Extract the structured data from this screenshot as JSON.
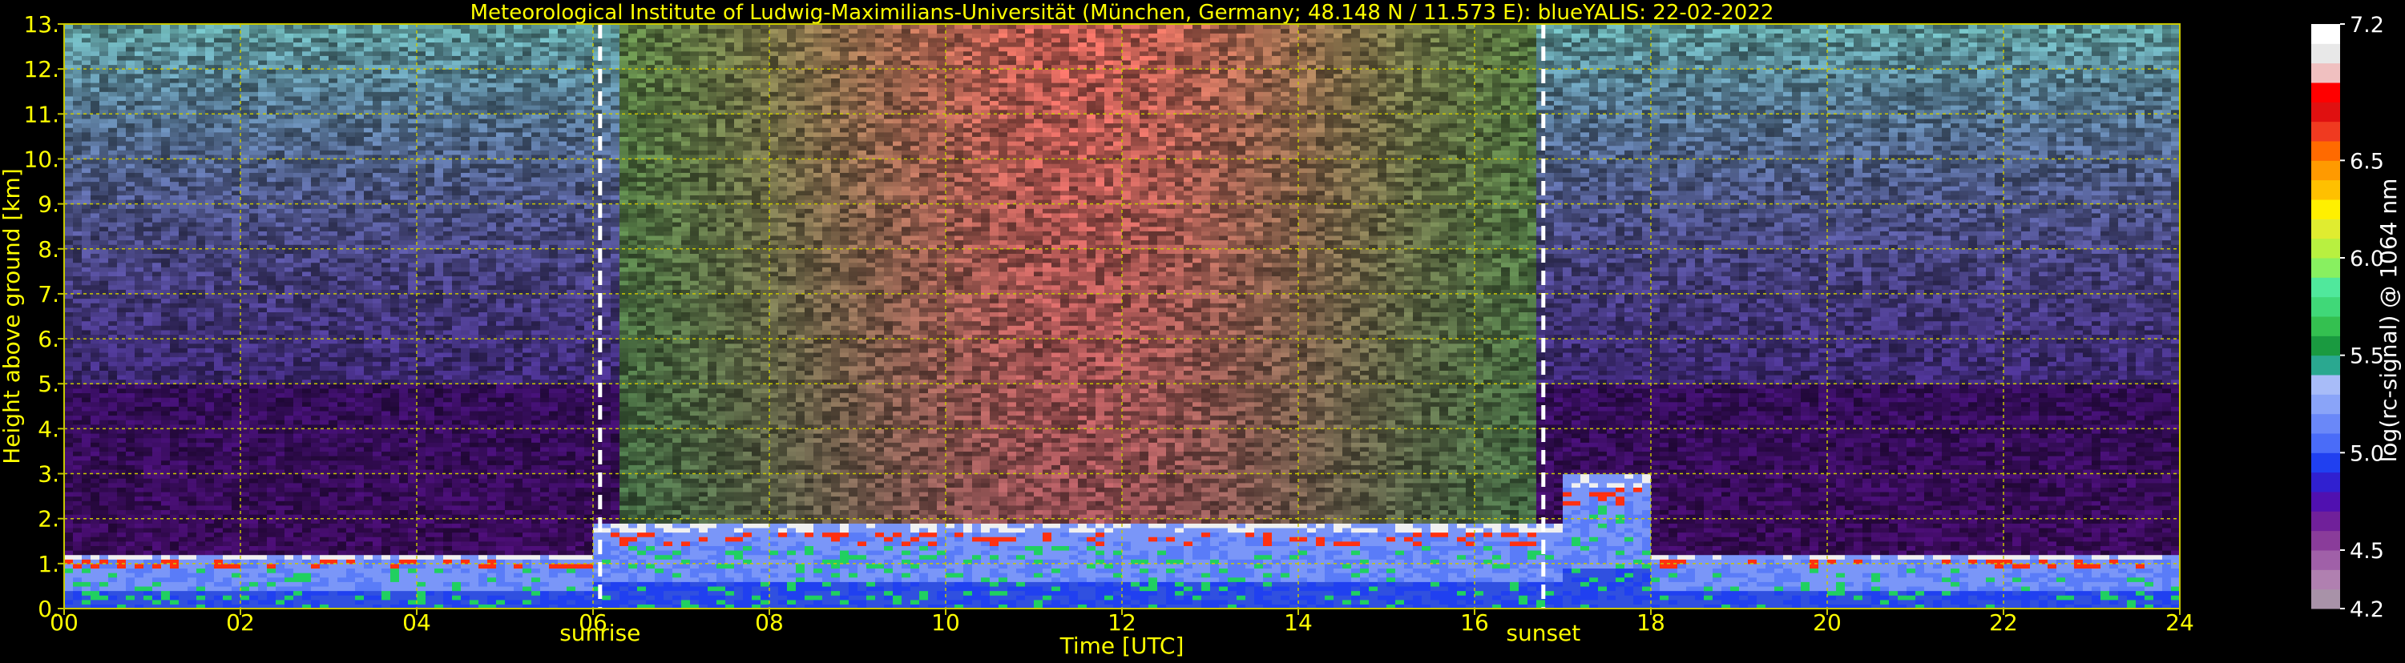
{
  "chart_data": {
    "type": "heatmap",
    "title": "Meteorological Institute of Ludwig-Maximilians-Universität (München, Germany; 48.148 N / 11.573 E):     blueYALIS: 22-02-2022",
    "xlabel": "Time [UTC]",
    "ylabel": "Height above ground [km]",
    "xlim": [
      0,
      24
    ],
    "ylim": [
      0,
      13
    ],
    "x_ticks": [
      "00",
      "02",
      "04",
      "06",
      "08",
      "10",
      "12",
      "14",
      "16",
      "18",
      "20",
      "22",
      "24"
    ],
    "y_ticks": [
      "0.",
      "1.",
      "2.",
      "3.",
      "4.",
      "5.",
      "6.",
      "7.",
      "8.",
      "9.",
      "10.",
      "11.",
      "12.",
      "13."
    ],
    "grid": true,
    "markers": [
      {
        "label": "sunrise",
        "time": 6.08
      },
      {
        "label": "sunset",
        "time": 16.78
      }
    ],
    "colorbar": {
      "label": "log(rc-signal) @ 1064 nm",
      "ticks": [
        "7.2",
        "6.5",
        "6.0",
        "5.5",
        "5.0",
        "4.5",
        "4.2"
      ],
      "tick_values": [
        7.2,
        6.5,
        6.0,
        5.5,
        5.0,
        4.5,
        4.2
      ],
      "range": [
        4.2,
        7.2
      ],
      "colors": [
        "#a892a8",
        "#b080b0",
        "#a060a8",
        "#8a3c9a",
        "#70209a",
        "#5010b0",
        "#3020d0",
        "#2040f0",
        "#4a6cf8",
        "#6a88f8",
        "#8aa4f8",
        "#a8bcf8",
        "#2aa890",
        "#1a9a40",
        "#34c050",
        "#40d878",
        "#50e89c",
        "#88f060",
        "#b8f040",
        "#e0ec30",
        "#fff000",
        "#ffc000",
        "#ff9a00",
        "#ff6a00",
        "#f03a20",
        "#e01010",
        "#ff0000",
        "#f0c0c0",
        "#e8e8e8",
        "#ffffff"
      ]
    }
  },
  "colors": {
    "text": "#ffff00",
    "grid": "#c8c800",
    "marker": "#ffffff",
    "background": "#000000"
  }
}
